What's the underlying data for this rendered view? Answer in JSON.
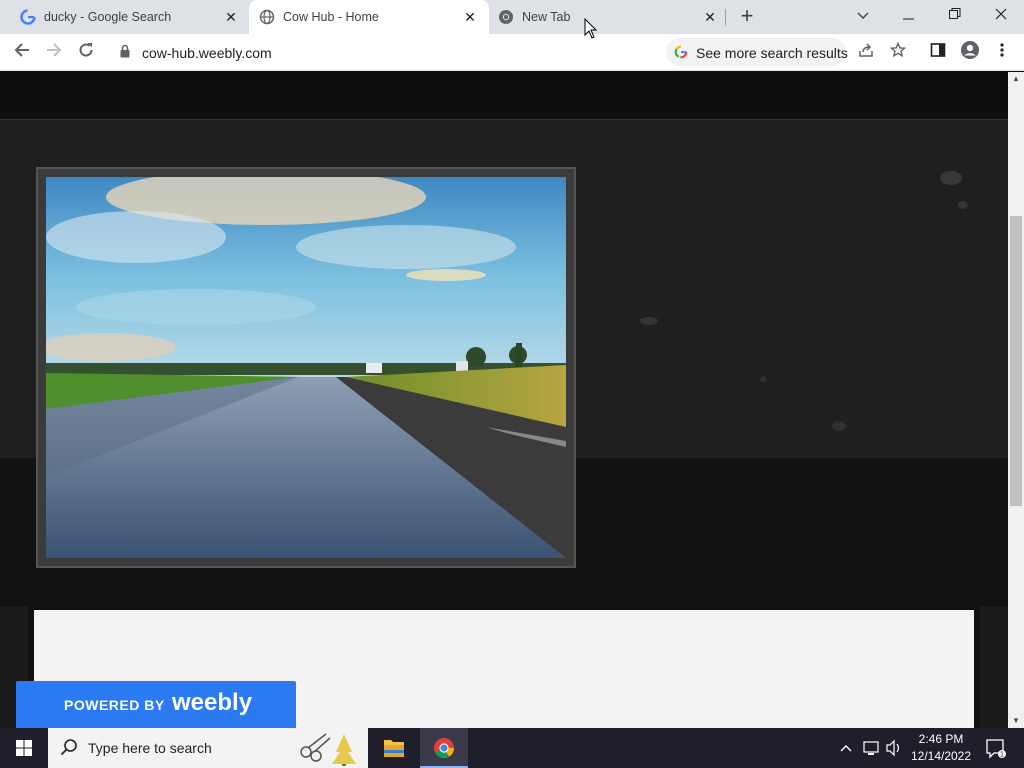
{
  "browser": {
    "tabs": [
      {
        "title": "ducky - Google Search",
        "active": false,
        "favicon": "google-g-icon"
      },
      {
        "title": "Cow Hub - Home",
        "active": true,
        "favicon": "globe-icon"
      },
      {
        "title": "New Tab",
        "active": false,
        "favicon": "chrome-icon"
      }
    ],
    "url": "cow-hub.weebly.com",
    "search_chip": "See more search results"
  },
  "page": {
    "badge_powered": "POWERED BY",
    "badge_brand": "weebly"
  },
  "taskbar": {
    "search_placeholder": "Type here to search",
    "time": "2:46 PM",
    "date": "12/14/2022"
  },
  "colors": {
    "accent": "#2c7af2",
    "tab_strip": "#dee1e6",
    "page_dark": "#1b1b1b"
  }
}
